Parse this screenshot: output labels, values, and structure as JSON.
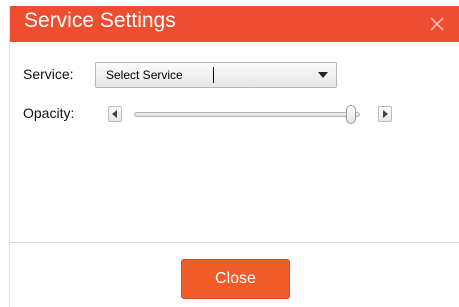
{
  "dialog": {
    "title": "Service Settings",
    "close_button_label": "Close",
    "accent_color": "#ef4d2f",
    "button_color": "#f15a29"
  },
  "service": {
    "label": "Service:",
    "selected": "Select Service"
  },
  "opacity": {
    "label": "Opacity:",
    "value_fraction": 0.98
  },
  "icons": {
    "close": "close-x-icon",
    "dropdown": "chevron-down-icon",
    "left": "arrow-left-icon",
    "right": "arrow-right-icon"
  }
}
